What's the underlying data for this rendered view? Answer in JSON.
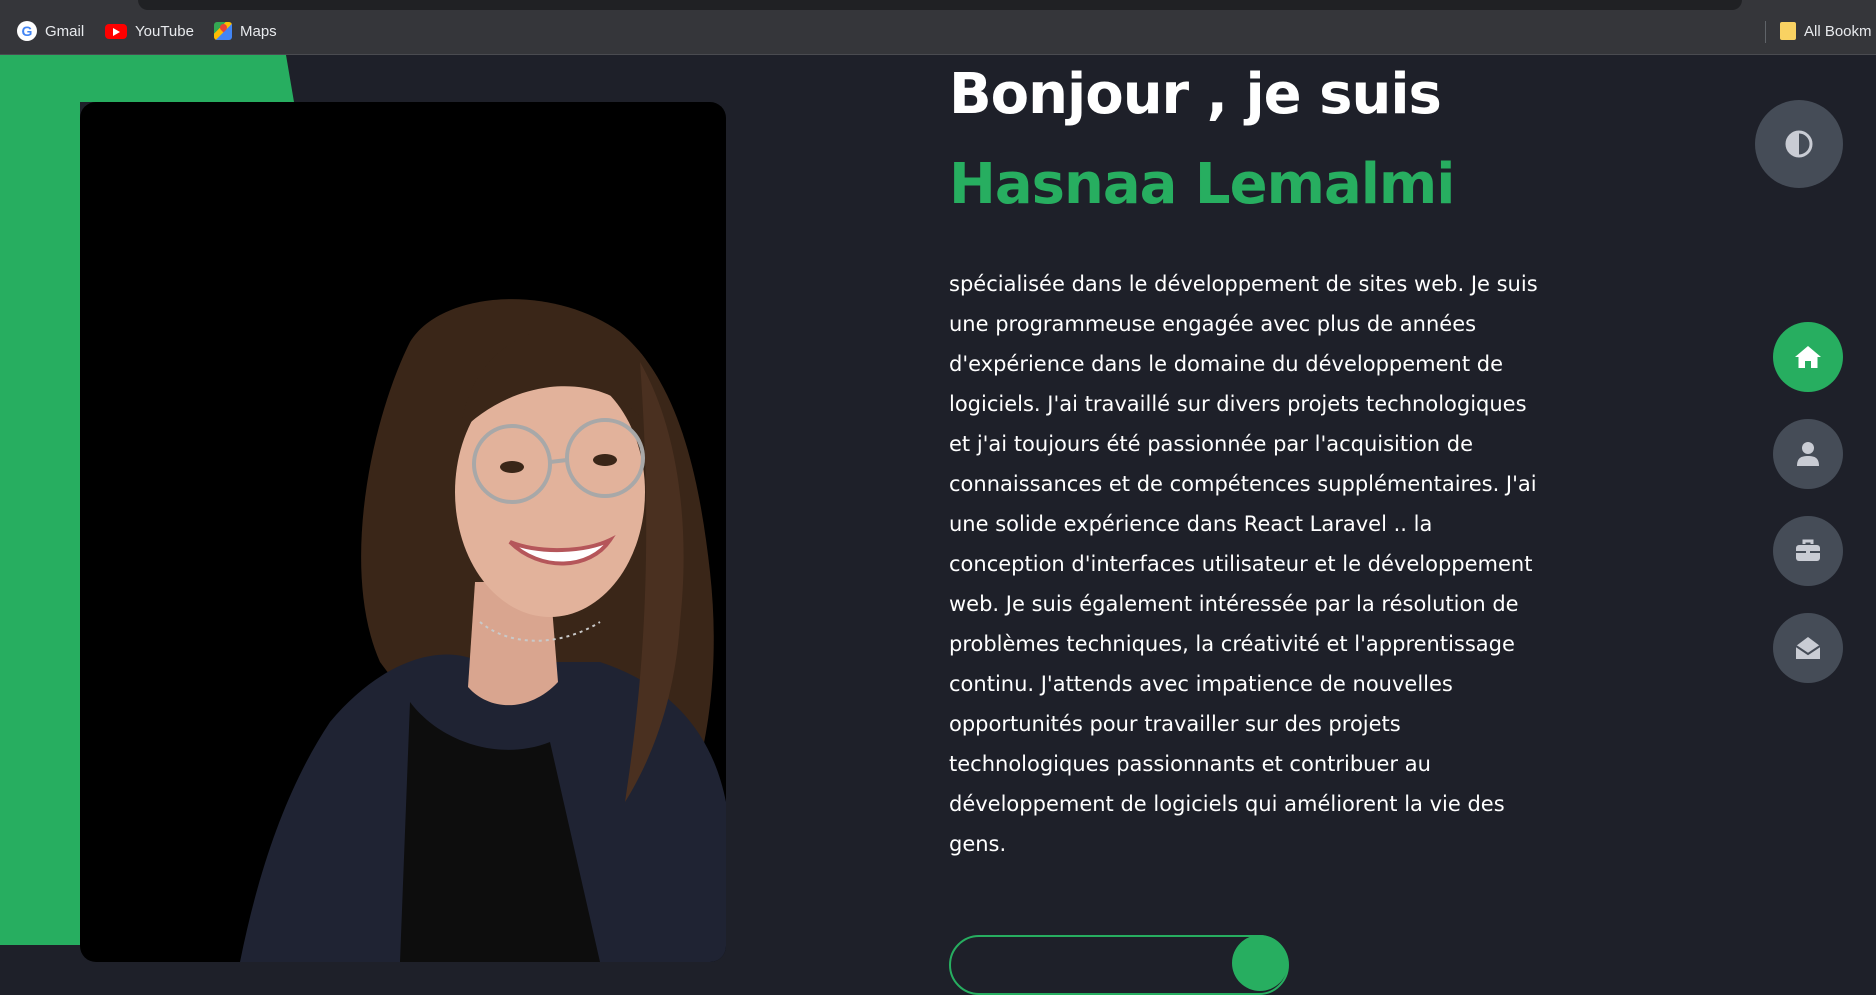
{
  "bookmarks": {
    "items": [
      {
        "label": "Gmail",
        "icon": "google-icon"
      },
      {
        "label": "YouTube",
        "icon": "youtube-icon"
      },
      {
        "label": "Maps",
        "icon": "maps-icon"
      }
    ],
    "all_bookmarks_label": "All Bookm"
  },
  "hero": {
    "greeting": "Bonjour , je suis",
    "name": "Hasnaa Lemalmi",
    "bio": "spécialisée dans le développement de sites web. Je suis une programmeuse engagée avec plus de années d'expérience dans le domaine du développement de logiciels. J'ai travaillé sur divers projets technologiques et j'ai toujours été passionnée par l'acquisition de connaissances et de compétences supplémentaires. J'ai une solide expérience dans React Laravel .. la conception d'interfaces utilisateur et le développement web. Je suis également intéressée par la résolution de problèmes techniques, la créativité et l'apprentissage continu. J'attends avec impatience de nouvelles opportunités pour travailler sur des projets technologiques passionnants et contribuer au développement de logiciels qui améliorent la vie des gens."
  },
  "nav": {
    "theme_toggle_icon": "contrast-icon",
    "items": [
      {
        "icon": "home-icon",
        "active": true
      },
      {
        "icon": "user-icon",
        "active": false
      },
      {
        "icon": "briefcase-icon",
        "active": false
      },
      {
        "icon": "envelope-open-icon",
        "active": false
      }
    ]
  },
  "colors": {
    "accent": "#27ae60",
    "background": "#1e2029",
    "nav_button": "#454c57"
  }
}
